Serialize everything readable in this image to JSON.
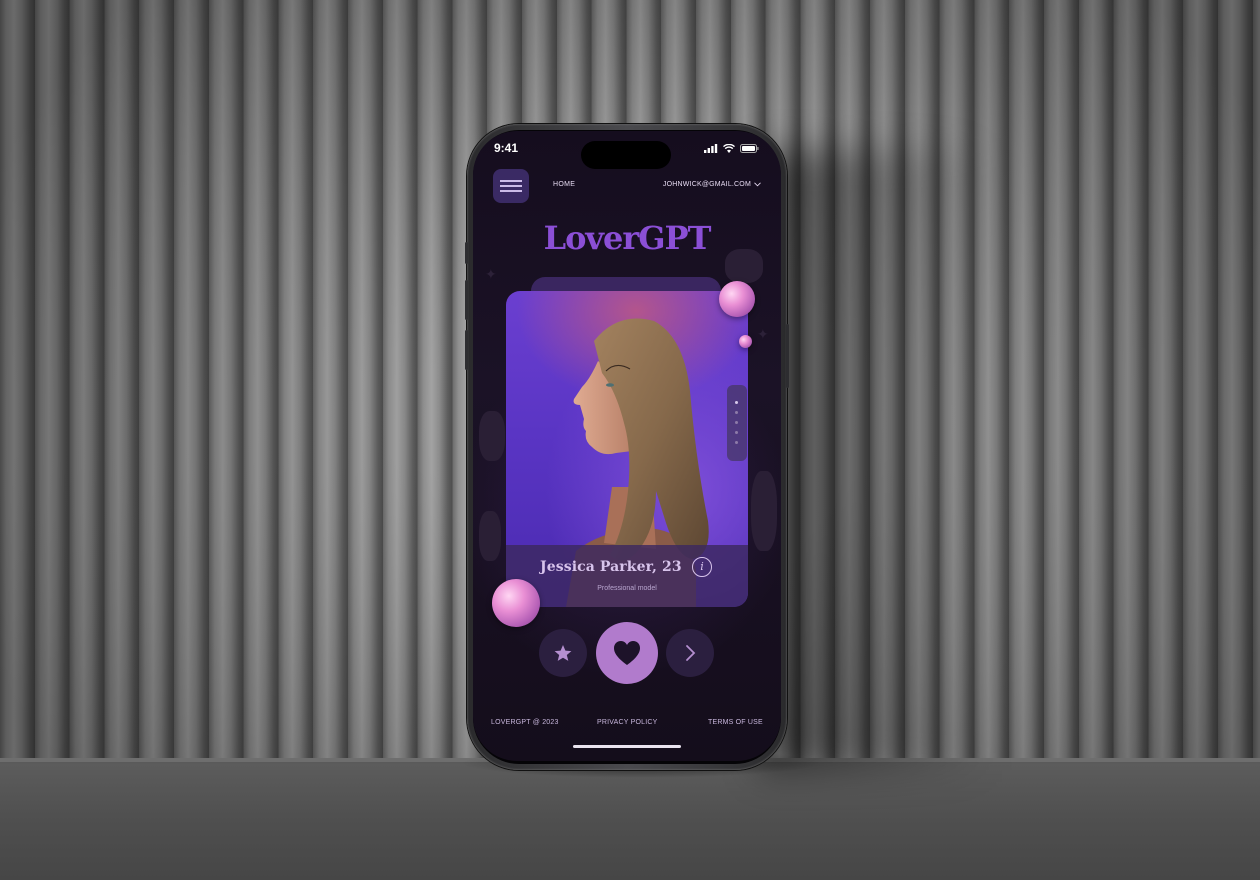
{
  "status_bar": {
    "time": "9:41"
  },
  "nav": {
    "menu_icon": "hamburger-menu-icon",
    "home_label": "HOME",
    "email_label": "JOHNWICK@GMAIL.COM",
    "dropdown_icon": "chevron-down-icon"
  },
  "brand": {
    "title": "LoverGPT"
  },
  "profile": {
    "name": "Jessica Parker, 23",
    "info_icon_label": "i",
    "role": "Professional model",
    "photo_count": 5,
    "active_photo": 1
  },
  "actions": {
    "favorite_icon": "star-icon",
    "like_icon": "heart-icon",
    "next_icon": "chevron-right-icon"
  },
  "footer": {
    "copyright": "LOVERGPT @ 2023",
    "privacy": "PRIVACY POLICY",
    "terms": "TERMS OF USE"
  },
  "colors": {
    "brand": "#8b4fd6",
    "background": "#1b1226",
    "accent": "#b17bcc",
    "card": "#5a35c4"
  }
}
